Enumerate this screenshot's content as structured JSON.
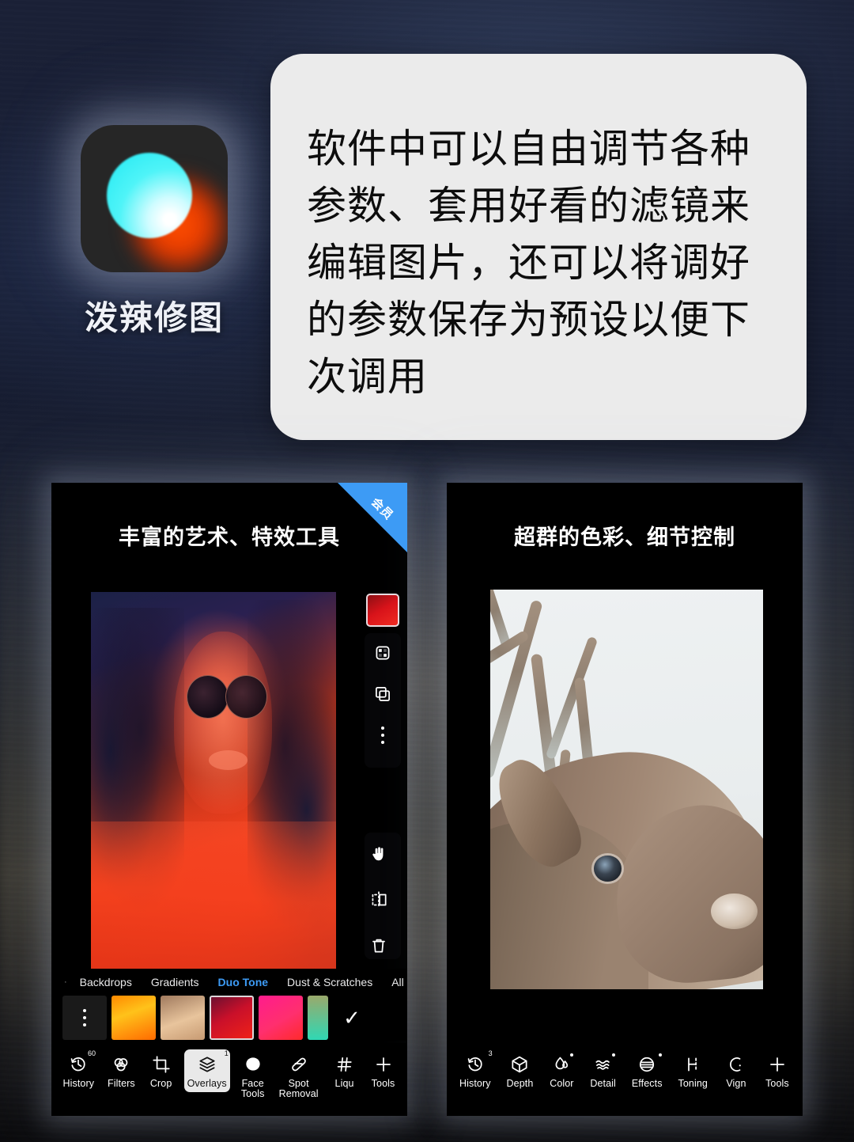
{
  "background": {
    "base_color": "#151a2b",
    "accent": "#3d9bf5"
  },
  "app": {
    "name": "泼辣修图",
    "icon_name": "polarr-app-icon"
  },
  "bubble": {
    "text": "软件中可以自由调节各种参数、套用好看的滤镜来编辑图片，还可以将调好的参数保存为预设以便下次调用"
  },
  "cards": [
    {
      "title": "丰富的艺术、特效工具",
      "ribbon": "会员",
      "photo": "duotone-portrait-woman-sunglasses",
      "rail_top": [
        {
          "name": "color-swatch-red",
          "icon": "swatch"
        },
        {
          "name": "checkerboard-icon",
          "icon": "checker"
        },
        {
          "name": "duplicate-layer-icon",
          "icon": "copy"
        },
        {
          "name": "more-options-icon",
          "icon": "dots"
        }
      ],
      "rail_bottom": [
        {
          "name": "pan-hand-icon",
          "icon": "hand"
        },
        {
          "name": "mirror-flip-icon",
          "icon": "mirror"
        },
        {
          "name": "delete-icon",
          "icon": "trash"
        },
        {
          "name": "eyedropper-icon",
          "icon": "dropper",
          "active": true
        }
      ],
      "tabs": [
        {
          "label": "Backdrops",
          "active": false
        },
        {
          "label": "Gradients",
          "active": false
        },
        {
          "label": "Duo Tone",
          "active": true
        },
        {
          "label": "Dust & Scratches",
          "active": false
        },
        {
          "label": "All",
          "active": false
        }
      ],
      "swatches": [
        {
          "name": "swatch-menu",
          "color": "#1a1a1a",
          "menu": true
        },
        {
          "name": "swatch-orange",
          "color": "linear-gradient(160deg,#ff8a00,#ffc21a 40%,#ff6a00 100%)"
        },
        {
          "name": "swatch-tan",
          "color": "linear-gradient(160deg,#a07a5e,#e8c49c 55%,#c79a72 100%)"
        },
        {
          "name": "swatch-crimson",
          "color": "linear-gradient(150deg,#6d1030,#c9102a 45%,#ef2118 100%)",
          "selected": true
        },
        {
          "name": "swatch-magenta",
          "color": "linear-gradient(150deg,#ff1c8d,#ff2f6e 55%,#ff2a2a 100%)"
        },
        {
          "name": "swatch-teal",
          "color": "linear-gradient(180deg,#9aa96b,#2fd8b4 100%)"
        }
      ],
      "confirm": "✓",
      "tools": [
        {
          "label": "History",
          "icon": "history",
          "badge": "60"
        },
        {
          "label": "Filters",
          "icon": "filters"
        },
        {
          "label": "Crop",
          "icon": "crop"
        },
        {
          "label": "Overlays",
          "icon": "overlays",
          "badge": "1",
          "selected": true
        },
        {
          "label": "Face\nTools",
          "icon": "face"
        },
        {
          "label": "Spot\nRemoval",
          "icon": "spot"
        },
        {
          "label": "Liqu",
          "icon": "liquify"
        },
        {
          "label": "Tools",
          "icon": "plus"
        }
      ]
    },
    {
      "title": "超群的色彩、细节控制",
      "ribbon": null,
      "photo": "deer-stag-portrait",
      "tools": [
        {
          "label": "History",
          "icon": "history",
          "badge": "3"
        },
        {
          "label": "Depth",
          "icon": "depth"
        },
        {
          "label": "Color",
          "icon": "color",
          "dot": true
        },
        {
          "label": "Detail",
          "icon": "detail",
          "dot": true
        },
        {
          "label": "Effects",
          "icon": "effects",
          "dot": true
        },
        {
          "label": "Toning",
          "icon": "toning"
        },
        {
          "label": "Vign",
          "icon": "vignette"
        },
        {
          "label": "Tools",
          "icon": "plus"
        }
      ]
    }
  ]
}
